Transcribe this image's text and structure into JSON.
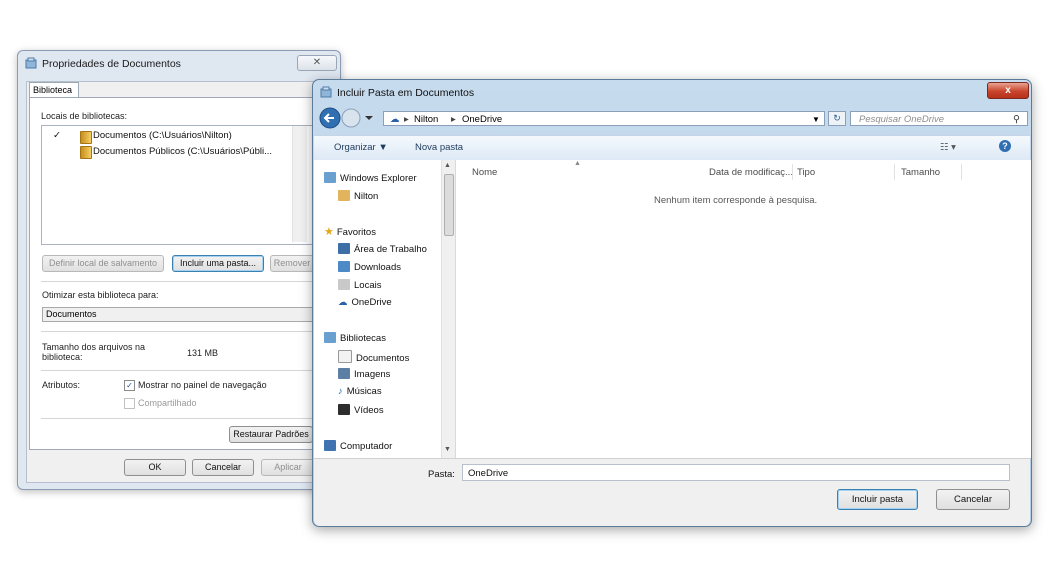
{
  "props_dialog": {
    "title": "Propriedades de Documentos",
    "close_label": "✕",
    "tab_label": "Biblioteca",
    "locations_label": "Locais de bibliotecas:",
    "locations": [
      {
        "check": "✓",
        "text": "Documentos (C:\\Usuários\\Nilton)"
      },
      {
        "check": "",
        "text": "Documentos Públicos (C:\\Usuários\\Públi..."
      }
    ],
    "btn_set_save": "Definir local de salvamento",
    "btn_include_folder": "Incluir uma pasta...",
    "btn_remove": "Remover",
    "optimize_label": "Otimizar esta biblioteca para:",
    "optimize_value": "Documentos",
    "size_label": "Tamanho dos arquivos na biblioteca:",
    "size_value": "131 MB",
    "attributes_label": "Atributos:",
    "show_nav_label": "Mostrar no painel de navegação",
    "show_nav_checked": "✓",
    "shared_label": "Compartilhado",
    "btn_restore": "Restaurar Padrões",
    "btn_ok": "OK",
    "btn_cancel": "Cancelar",
    "btn_apply": "Aplicar"
  },
  "include_dialog": {
    "title": "Incluir Pasta em Documentos",
    "close_label": "x",
    "breadcrumb": [
      "Nilton",
      "OneDrive"
    ],
    "search_placeholder": "Pesquisar OneDrive",
    "toolbar": {
      "organize": "Organizar ▼",
      "new_folder": "Nova pasta"
    },
    "nav": {
      "windows_explorer": "Windows Explorer",
      "user": "Nilton",
      "favorites_header": "Favoritos",
      "favorites": [
        "Área de Trabalho",
        "Downloads",
        "Locais",
        "OneDrive"
      ],
      "libraries_header": "Bibliotecas",
      "libraries": [
        "Documentos",
        "Imagens",
        "Músicas",
        "Vídeos"
      ],
      "computer": "Computador"
    },
    "columns": [
      "Nome",
      "Data de modificaç...",
      "Tipo",
      "Tamanho"
    ],
    "empty_message": "Nenhum item corresponde à pesquisa.",
    "folder_label": "Pasta:",
    "folder_value": "OneDrive",
    "btn_include": "Incluir pasta",
    "btn_cancel": "Cancelar"
  },
  "colors": {
    "accent": "#3c7fb1",
    "close_red": "#c8452c",
    "titlebar": "#c7dbee"
  }
}
